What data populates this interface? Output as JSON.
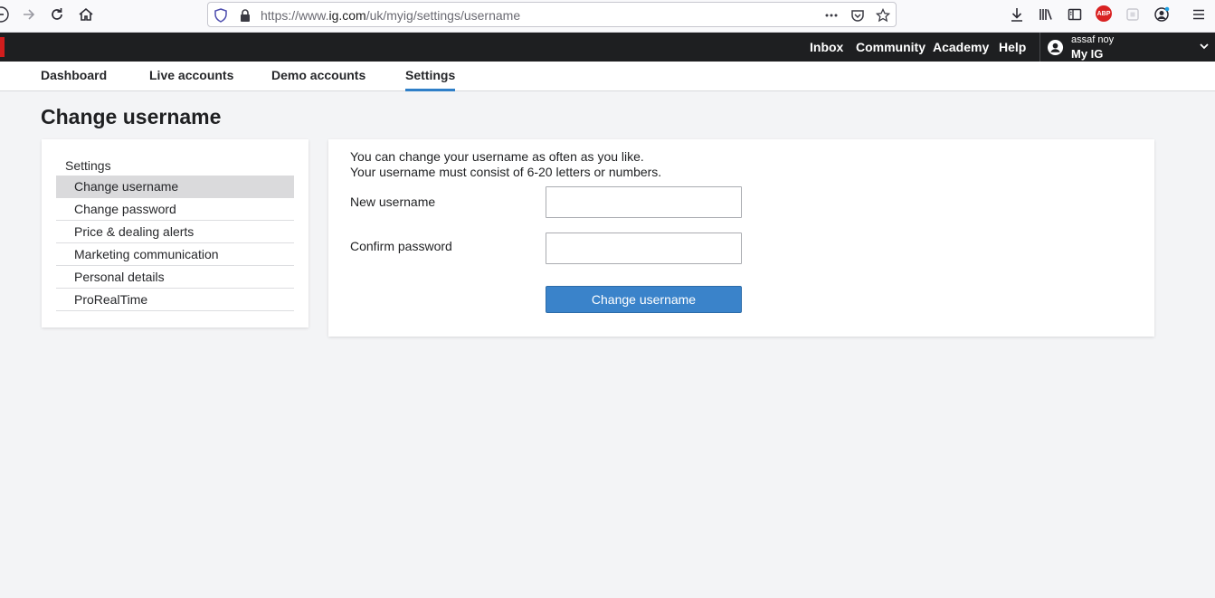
{
  "browser": {
    "url_prefix": "https://www.",
    "url_host": "ig.com",
    "url_path": "/uk/myig/settings/username",
    "abp_label": "ABP"
  },
  "topbar": {
    "links": [
      "Inbox",
      "Community",
      "Academy",
      "Help"
    ],
    "account_name": "assaf noy",
    "account_label": "My IG"
  },
  "tabs": [
    {
      "label": "Dashboard",
      "active": false
    },
    {
      "label": "Live accounts",
      "active": false
    },
    {
      "label": "Demo accounts",
      "active": false
    },
    {
      "label": "Settings",
      "active": true
    }
  ],
  "page": {
    "title": "Change username"
  },
  "sidebar": {
    "heading": "Settings",
    "items": [
      {
        "label": "Change username",
        "active": true
      },
      {
        "label": "Change password",
        "active": false
      },
      {
        "label": "Price & dealing alerts",
        "active": false
      },
      {
        "label": "Marketing communication",
        "active": false
      },
      {
        "label": "Personal details",
        "active": false
      },
      {
        "label": "ProRealTime",
        "active": false
      }
    ]
  },
  "form": {
    "intro_line1": "You can change your username as often as you like.",
    "intro_line2": "Your username must consist of 6-20 letters or numbers.",
    "new_username_label": "New username",
    "new_username_value": "",
    "confirm_password_label": "Confirm password",
    "confirm_password_value": "",
    "submit_label": "Change username"
  },
  "colors": {
    "accent": "#3a83ca",
    "topbar_bg": "#1e1f21",
    "brand_red": "#d11d1d",
    "page_bg": "#f3f4f6"
  }
}
